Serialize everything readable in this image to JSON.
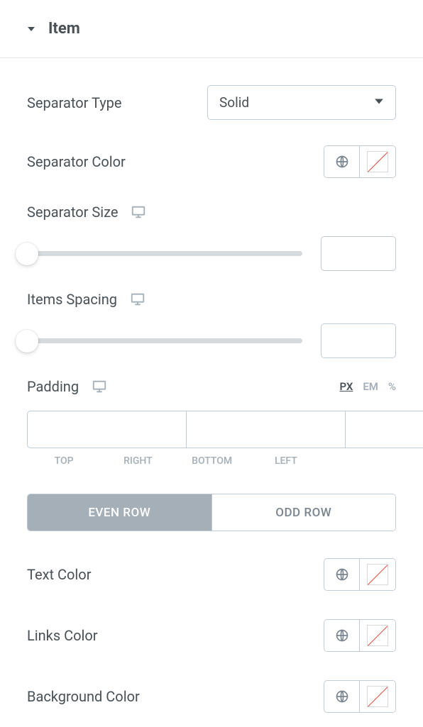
{
  "section": {
    "title": "Item"
  },
  "separator_type": {
    "label": "Separator Type",
    "value": "Solid"
  },
  "separator_color": {
    "label": "Separator Color"
  },
  "separator_size": {
    "label": "Separator Size",
    "value": ""
  },
  "items_spacing": {
    "label": "Items Spacing",
    "value": ""
  },
  "padding": {
    "label": "Padding",
    "units": {
      "px": "PX",
      "em": "EM",
      "pct": "%"
    },
    "sides": {
      "top": "TOP",
      "right": "RIGHT",
      "bottom": "BOTTOM",
      "left": "LEFT"
    },
    "values": {
      "top": "",
      "right": "",
      "bottom": "",
      "left": ""
    }
  },
  "row_toggle": {
    "even": "EVEN ROW",
    "odd": "ODD ROW"
  },
  "text_color": {
    "label": "Text Color"
  },
  "links_color": {
    "label": "Links Color"
  },
  "background_color": {
    "label": "Background Color"
  }
}
